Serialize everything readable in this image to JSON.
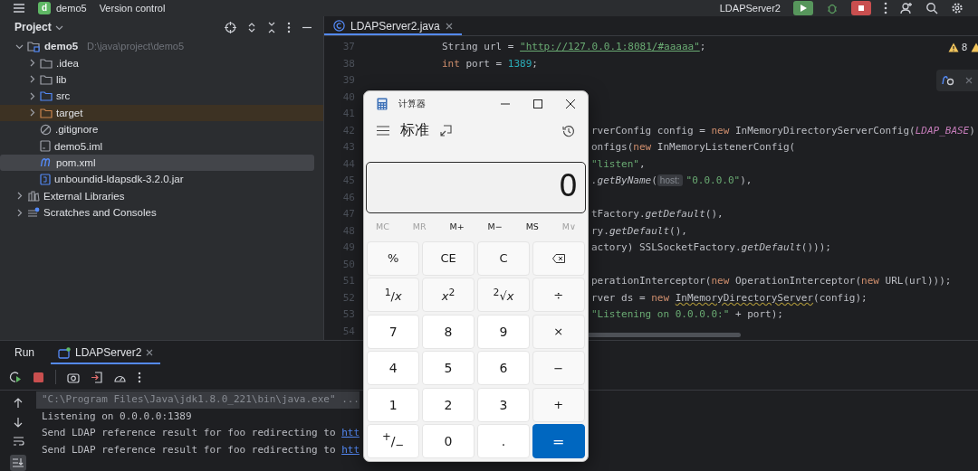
{
  "top_bar": {
    "project_badge": "d",
    "project": "demo5",
    "vcs": "Version control",
    "run_config": "LDAPServer2"
  },
  "project": {
    "title": "Project",
    "tree": [
      {
        "label": "demo5",
        "path": "D:\\java\\project\\demo5",
        "kind": "module",
        "expanded": true,
        "selected": false,
        "children": [
          {
            "label": ".idea",
            "kind": "folder",
            "expanded": false,
            "selected": false
          },
          {
            "label": "lib",
            "kind": "folder",
            "expanded": false,
            "selected": false
          },
          {
            "label": "src",
            "kind": "source-folder",
            "expanded": false,
            "selected": false
          },
          {
            "label": "target",
            "kind": "excluded-folder",
            "expanded": false,
            "selected": false
          },
          {
            "label": ".gitignore",
            "kind": "ignore-file",
            "selected": false
          },
          {
            "label": "demo5.iml",
            "kind": "module-file",
            "selected": false
          },
          {
            "label": "pom.xml",
            "kind": "maven-file",
            "selected": true
          },
          {
            "label": "unboundid-ldapsdk-3.2.0.jar",
            "kind": "jar",
            "selected": false
          }
        ]
      },
      {
        "label": "External Libraries",
        "kind": "libraries",
        "expanded": false,
        "selected": false
      },
      {
        "label": "Scratches and Consoles",
        "kind": "scratches",
        "expanded": false,
        "selected": false
      }
    ]
  },
  "editor": {
    "tab": {
      "label": "LDAPServer2.java",
      "selected": true
    },
    "warnings": "8",
    "lines": [
      {
        "number": "37",
        "kind": "full",
        "tokens": [
          {
            "t": "String url = ",
            "kind": "plain"
          },
          {
            "t": "\"http://127.0.0.1:8081/#aaaaa\"",
            "kind": "url"
          },
          {
            "t": ";",
            "kind": "plain"
          }
        ]
      },
      {
        "number": "38",
        "kind": "full",
        "tokens": [
          {
            "t": "int",
            "kind": "kw"
          },
          {
            "t": " port = ",
            "kind": "plain"
          },
          {
            "t": "1389",
            "kind": "num"
          },
          {
            "t": ";",
            "kind": "plain"
          }
        ]
      },
      {
        "number": "39",
        "kind": "full"
      },
      {
        "number": "40",
        "kind": "full"
      },
      {
        "number": "41",
        "kind": "full"
      },
      {
        "number": "42",
        "kind": "fragment",
        "tokens": [
          {
            "t": "rverConfig config = ",
            "kind": "plain"
          },
          {
            "t": "new",
            "kind": "kw"
          },
          {
            "t": " InMemoryDirectoryServerConfig(",
            "kind": "plain"
          },
          {
            "t": "LDAP_BASE",
            "kind": "const"
          },
          {
            "t": ")",
            "kind": "plain"
          }
        ]
      },
      {
        "number": "43",
        "kind": "fragment",
        "tokens": [
          {
            "t": "onfigs(",
            "kind": "plain"
          },
          {
            "t": "new",
            "kind": "kw"
          },
          {
            "t": " InMemoryListenerConfig(",
            "kind": "plain"
          }
        ]
      },
      {
        "number": "44",
        "kind": "fragment",
        "tokens": [
          {
            "t": "\"listen\"",
            "kind": "str"
          },
          {
            "t": ",",
            "kind": "plain"
          }
        ]
      },
      {
        "number": "45",
        "kind": "fragment",
        "tokens": [
          {
            "t": ".getByName",
            "kind": "method"
          },
          {
            "t": "(",
            "kind": "plain"
          },
          {
            "t": "host:",
            "kind": "hint"
          },
          {
            "t": "\"0.0.0.0\"",
            "kind": "str"
          },
          {
            "t": "),",
            "kind": "plain"
          }
        ]
      },
      {
        "number": "46",
        "kind": "fragment"
      },
      {
        "number": "47",
        "kind": "fragment",
        "tokens": [
          {
            "t": "tFactory.",
            "kind": "plain"
          },
          {
            "t": "getDefault",
            "kind": "method"
          },
          {
            "t": "(),",
            "kind": "plain"
          }
        ]
      },
      {
        "number": "48",
        "kind": "fragment",
        "tokens": [
          {
            "t": "ry.",
            "kind": "plain"
          },
          {
            "t": "getDefault",
            "kind": "method"
          },
          {
            "t": "(),",
            "kind": "plain"
          }
        ]
      },
      {
        "number": "49",
        "kind": "fragment",
        "tokens": [
          {
            "t": "actory) SSLSocketFactory.",
            "kind": "plain"
          },
          {
            "t": "getDefault",
            "kind": "method"
          },
          {
            "t": "()));",
            "kind": "plain"
          }
        ]
      },
      {
        "number": "50",
        "kind": "fragment"
      },
      {
        "number": "51",
        "kind": "fragment",
        "tokens": [
          {
            "t": "perationInterceptor(",
            "kind": "plain"
          },
          {
            "t": "new",
            "kind": "kw"
          },
          {
            "t": " OperationInterceptor(",
            "kind": "plain"
          },
          {
            "t": "new",
            "kind": "kw"
          },
          {
            "t": " URL(url)));",
            "kind": "plain"
          }
        ]
      },
      {
        "number": "52",
        "kind": "fragment",
        "tokens": [
          {
            "t": "rver ds = ",
            "kind": "plain"
          },
          {
            "t": "new ",
            "kind": "kw"
          },
          {
            "t": "InMemoryDirectoryServer",
            "kind": "warn"
          },
          {
            "t": "(config);",
            "kind": "plain"
          }
        ]
      },
      {
        "number": "53",
        "kind": "fragment",
        "tokens": [
          {
            "t": "\"Listening on 0.0.0.0:\"",
            "kind": "str"
          },
          {
            "t": " + port);",
            "kind": "plain"
          }
        ]
      },
      {
        "number": "54",
        "kind": "fragment"
      }
    ]
  },
  "run": {
    "title": "Run",
    "tab": {
      "label": "LDAPServer2",
      "selected": true
    },
    "console": [
      {
        "kind": "command",
        "text": "\"C:\\Program Files\\Java\\jdk1.8.0_221\\bin\\java.exe\" ..."
      },
      {
        "kind": "output",
        "text": "Listening on 0.0.0.0:1389"
      },
      {
        "kind": "output",
        "text": "Send LDAP reference result for foo redirecting to ",
        "link": "htt"
      },
      {
        "kind": "output",
        "text": "Send LDAP reference result for foo redirecting to ",
        "link": "htt"
      }
    ]
  },
  "calculator": {
    "title": "计算器",
    "mode": "标准",
    "display": "0",
    "memory": [
      {
        "label": "MC",
        "disabled": true
      },
      {
        "label": "MR",
        "disabled": true
      },
      {
        "label": "M+",
        "disabled": false
      },
      {
        "label": "M−",
        "disabled": false
      },
      {
        "label": "MS",
        "disabled": false
      },
      {
        "label": "M∨",
        "disabled": true
      }
    ],
    "keys": [
      {
        "label": "%",
        "kind": "function"
      },
      {
        "label": "CE",
        "kind": "function"
      },
      {
        "label": "C",
        "kind": "function"
      },
      {
        "kind": "backspace"
      },
      {
        "label": "$^{1}$/*x*",
        "kind": "function"
      },
      {
        "label": "*x*$^{2}$",
        "kind": "function"
      },
      {
        "label": "$^{2}$√*x*",
        "kind": "function"
      },
      {
        "label": "÷",
        "kind": "function"
      },
      {
        "label": "7",
        "kind": "digit"
      },
      {
        "label": "8",
        "kind": "digit"
      },
      {
        "label": "9",
        "kind": "digit"
      },
      {
        "label": "×",
        "kind": "function"
      },
      {
        "label": "4",
        "kind": "digit"
      },
      {
        "label": "5",
        "kind": "digit"
      },
      {
        "label": "6",
        "kind": "digit"
      },
      {
        "label": "−",
        "kind": "function"
      },
      {
        "label": "1",
        "kind": "digit"
      },
      {
        "label": "2",
        "kind": "digit"
      },
      {
        "label": "3",
        "kind": "digit"
      },
      {
        "label": "+",
        "kind": "function"
      },
      {
        "label": "$^{+}$/$_{−}$",
        "kind": "digit"
      },
      {
        "label": "0",
        "kind": "digit"
      },
      {
        "label": ".",
        "kind": "digit"
      },
      {
        "label": "=",
        "kind": "equals"
      }
    ]
  }
}
